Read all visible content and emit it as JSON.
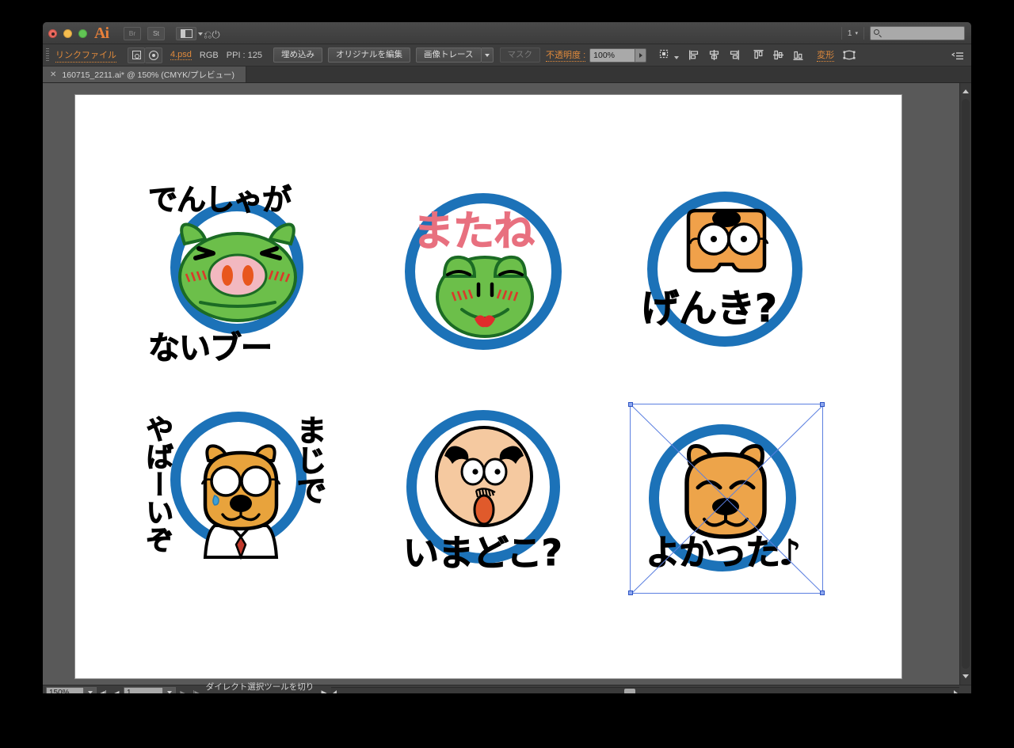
{
  "app": {
    "name": "Adobe Illustrator",
    "logo_text": "Ai"
  },
  "titlebar": {
    "bridge_label": "Br",
    "stock_label": "St",
    "arrange_label": "",
    "workspace_count": "1",
    "search_placeholder": "",
    "search_icon": "search-icon"
  },
  "controlbar": {
    "link_label": "リンクファイル",
    "filename": "4.psd",
    "color_mode": "RGB",
    "ppi": "PPI : 125",
    "embed_button": "埋め込み",
    "edit_original_button": "オリジナルを編集",
    "image_trace_button": "画像トレース",
    "mask_button": "マスク",
    "opacity_label": "不透明度 :",
    "opacity_value": "100%",
    "transform_label": "変形",
    "icons": [
      "select-similar-icon",
      "isolate-target-icon",
      "align-left-icon",
      "align-center-horizontal-icon",
      "align-right-icon",
      "align-top-icon",
      "align-center-vertical-icon",
      "align-bottom-icon",
      "envelope-distort-icon",
      "panel-menu-icon"
    ]
  },
  "tabbar": {
    "close_glyph": "✕",
    "document_title": "160715_2211.ai* @ 150% (CMYK/プレビュー)"
  },
  "statusbar": {
    "zoom_value": "150%",
    "page_value": "1",
    "status_text": "ダイレクト選択ツールを切り換え",
    "first_page_glyph": "◀|",
    "prev_page_glyph": "◀",
    "next_page_glyph": "▶",
    "last_page_glyph": "|▶"
  },
  "canvas": {
    "background_color": "#595959",
    "artboard_color": "#ffffff",
    "ring_color": "#1c72b8",
    "selection_color": "#5b7fe0",
    "stickers": [
      {
        "id": "sticker-pig-densha",
        "character": "green-pig",
        "text_top": "でんしゃが",
        "text_bottom": "ないブー",
        "text_color": "#000000",
        "face_color": "#6cbf4a",
        "selected": false
      },
      {
        "id": "sticker-frog-matane",
        "character": "green-frog",
        "text_top": "またね",
        "text_bottom": "",
        "text_color": "#e8707f",
        "face_color": "#6cbf4a",
        "selected": false
      },
      {
        "id": "sticker-dog-genki",
        "character": "orange-dog-glasses",
        "text_top": "",
        "text_bottom": "げんき?",
        "text_color": "#000000",
        "face_color": "#f0a council",
        "selected": false
      },
      {
        "id": "sticker-dog-majide",
        "character": "orange-dog-tie",
        "text_left": "やばーいぞ",
        "text_right": "まじで",
        "text_color": "#000000",
        "face_color": "#e8a councilde",
        "selected": false
      },
      {
        "id": "sticker-man-imadoko",
        "character": "bald-man",
        "text_top": "",
        "text_bottom": "いまどこ?",
        "text_color": "#000000",
        "face_color": "#f5c9a0",
        "selected": false
      },
      {
        "id": "sticker-dog-yokatta",
        "character": "orange-dog-happy",
        "text_top": "",
        "text_bottom": "よかった♪",
        "text_color": "#000000",
        "face_color": "#eda busc44",
        "selected": true
      }
    ]
  }
}
